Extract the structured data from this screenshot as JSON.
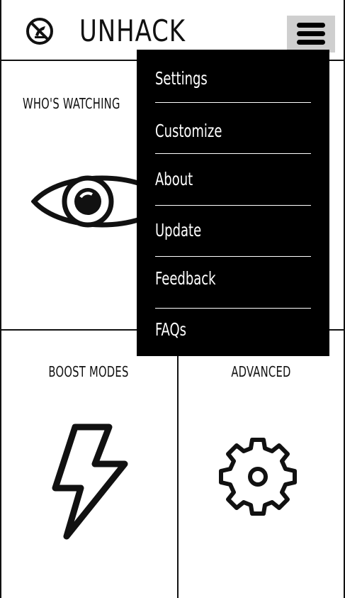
{
  "header": {
    "app_name": "UNHACK",
    "logo_icon": "unhack-logo-icon",
    "menu_icon": "hamburger-menu-icon"
  },
  "tiles": {
    "whos_watching": {
      "label": "WHO'S WATCHING",
      "icon": "eye-icon"
    },
    "boost_modes": {
      "label": "BOOST MODES",
      "icon": "lightning-bolt-icon"
    },
    "advanced": {
      "label": "ADVANCED",
      "icon": "gear-icon"
    }
  },
  "menu": {
    "items": [
      {
        "label": "Settings"
      },
      {
        "label": "Customize"
      },
      {
        "label": "About"
      },
      {
        "label": "Update"
      },
      {
        "label": "Feedback"
      },
      {
        "label": "FAQs"
      }
    ]
  },
  "colors": {
    "menu_background": "#000000",
    "menu_text": "#ffffff",
    "menu_button_background": "#cfcfcf",
    "line": "#111111"
  }
}
